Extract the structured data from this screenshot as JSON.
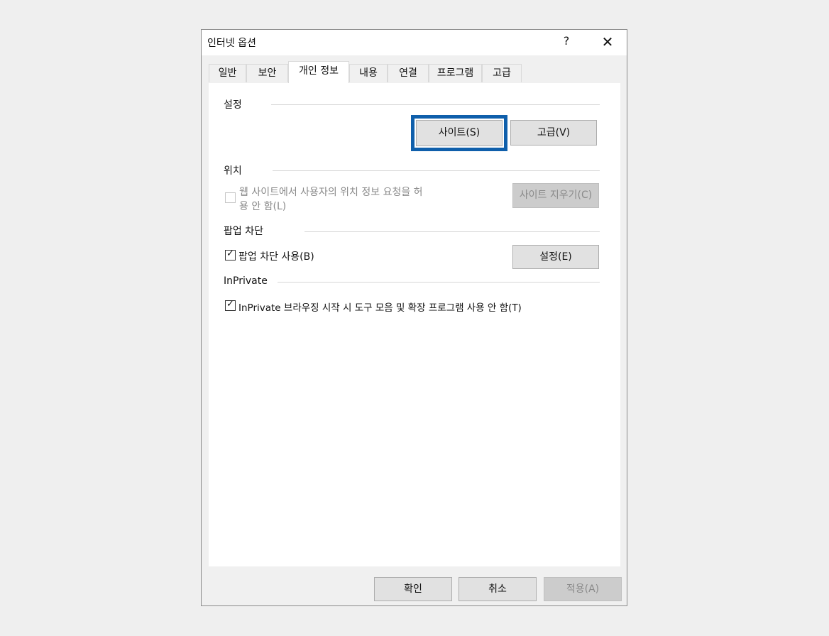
{
  "window": {
    "title": "인터넷 옵션",
    "help_label": "?",
    "close_label": "✕"
  },
  "tabs": [
    {
      "label": "일반",
      "active": false
    },
    {
      "label": "보안",
      "active": false
    },
    {
      "label": "개인 정보",
      "active": true
    },
    {
      "label": "내용",
      "active": false
    },
    {
      "label": "연결",
      "active": false
    },
    {
      "label": "프로그램",
      "active": false
    },
    {
      "label": "고급",
      "active": false
    }
  ],
  "settings": {
    "heading": "설정",
    "sites_button": "사이트(S)",
    "advanced_button": "고급(V)"
  },
  "location": {
    "heading": "위치",
    "checkbox_label_line1": "웹 사이트에서 사용자의 위치 정보 요청을 허",
    "checkbox_label_line2": "용 안 함(L)",
    "checked": false,
    "clear_sites_button": "사이트 지우기(C)"
  },
  "popup": {
    "heading": "팝업 차단",
    "checkbox_label": "팝업 차단 사용(B)",
    "checked": true,
    "settings_button": "설정(E)"
  },
  "inprivate": {
    "heading": "InPrivate",
    "checkbox_label": "InPrivate 브라우징 시작 시 도구 모음 및 확장 프로그램 사용 안 함(T)",
    "checked": true
  },
  "footer": {
    "ok_button": "확인",
    "cancel_button": "취소",
    "apply_button": "적용(A)"
  },
  "colors": {
    "focus_ring": "#0f5fab",
    "background": "#efefef",
    "panel": "#ffffff"
  }
}
